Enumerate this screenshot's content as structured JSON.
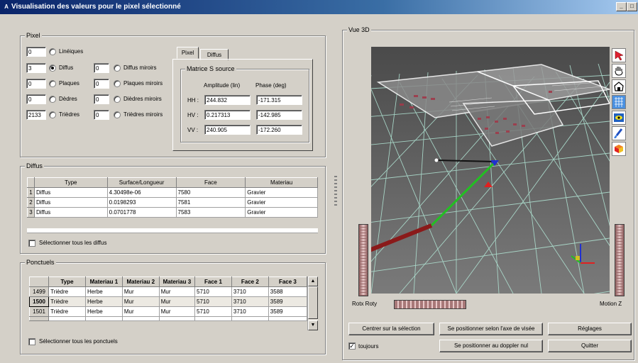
{
  "window": {
    "title": "Visualisation des valeurs pour le pixel sélectionné",
    "logo_letter": "A",
    "buttons": {
      "minimize": "_",
      "maximize": "□"
    }
  },
  "pixel_group": {
    "label": "Pixel",
    "rows": [
      {
        "count": "0",
        "label": "Linéiques",
        "selected": false
      },
      {
        "count": "3",
        "label": "Diffus",
        "selected": true,
        "mirror_count": "0",
        "mirror_label": "Diffus miroirs"
      },
      {
        "count": "0",
        "label": "Plaques",
        "selected": false,
        "mirror_count": "0",
        "mirror_label": "Plaques miroirs"
      },
      {
        "count": "0",
        "label": "Dèdres",
        "selected": false,
        "mirror_count": "0",
        "mirror_label": "Dièdres miroirs"
      },
      {
        "count": "2133",
        "label": "Trièdres",
        "selected": false,
        "mirror_count": "0",
        "mirror_label": "Trièdres miroirs"
      }
    ],
    "tabs": [
      "Pixel",
      "Diffus"
    ],
    "matrix": {
      "label": "Matrice S source",
      "col_amplitude": "Amplitude (lin)",
      "col_phase": "Phase (deg)",
      "rows": [
        {
          "label": "HH :",
          "amplitude": "244.832",
          "phase": "-171.315"
        },
        {
          "label": "HV :",
          "amplitude": "0.217313",
          "phase": "-142.985"
        },
        {
          "label": "VV :",
          "amplitude": "240.905",
          "phase": "-172.260"
        }
      ]
    }
  },
  "diffus_group": {
    "label": "Diffus",
    "columns": [
      "Type",
      "Surface/Longueur",
      "Face",
      "Materiau"
    ],
    "rows": [
      {
        "n": "1",
        "type": "Diffus",
        "surface": "4.30498e-06",
        "face": "7580",
        "materiau": "Gravier"
      },
      {
        "n": "2",
        "type": "Diffus",
        "surface": "0.0198293",
        "face": "7581",
        "materiau": "Gravier"
      },
      {
        "n": "3",
        "type": "Diffus",
        "surface": "0.0701778",
        "face": "7583",
        "materiau": "Gravier"
      }
    ],
    "select_all": "Sélectionner tous les diffus"
  },
  "ponctuels_group": {
    "label": "Ponctuels",
    "columns": [
      "Type",
      "Materiau 1",
      "Materiau 2",
      "Materiau 3",
      "Face 1",
      "Face 2",
      "Face 3"
    ],
    "rows": [
      {
        "n": "1499",
        "type": "Trièdre",
        "m1": "Herbe",
        "m2": "Mur",
        "m3": "Mur",
        "f1": "5710",
        "f2": "3710",
        "f3": "3588"
      },
      {
        "n": "1500",
        "type": "Trièdre",
        "m1": "Herbe",
        "m2": "Mur",
        "m3": "Mur",
        "f1": "5710",
        "f2": "3710",
        "f3": "3589"
      },
      {
        "n": "1501",
        "type": "Trièdre",
        "m1": "Herbe",
        "m2": "Mur",
        "m3": "Mur",
        "f1": "5710",
        "f2": "3710",
        "f3": "3589"
      }
    ],
    "select_all": "Sélectionner tous les ponctuels"
  },
  "vue3d": {
    "label": "Vue 3D",
    "rot_label": "Rotx  Roty",
    "motion_label": "Motion Z",
    "toolbar": [
      "cursor-icon",
      "hand-icon",
      "house-icon",
      "grid-view-icon",
      "eye-icon",
      "brush-icon",
      "cube-icon"
    ]
  },
  "actions": {
    "center": "Centrer sur la sélection",
    "sight_axis": "Se positionner selon l'axe de visée",
    "settings": "Réglages",
    "always_label": "toujours",
    "always_checked": true,
    "doppler": "Se positionner au doppler nul",
    "quit": "Quitter"
  }
}
